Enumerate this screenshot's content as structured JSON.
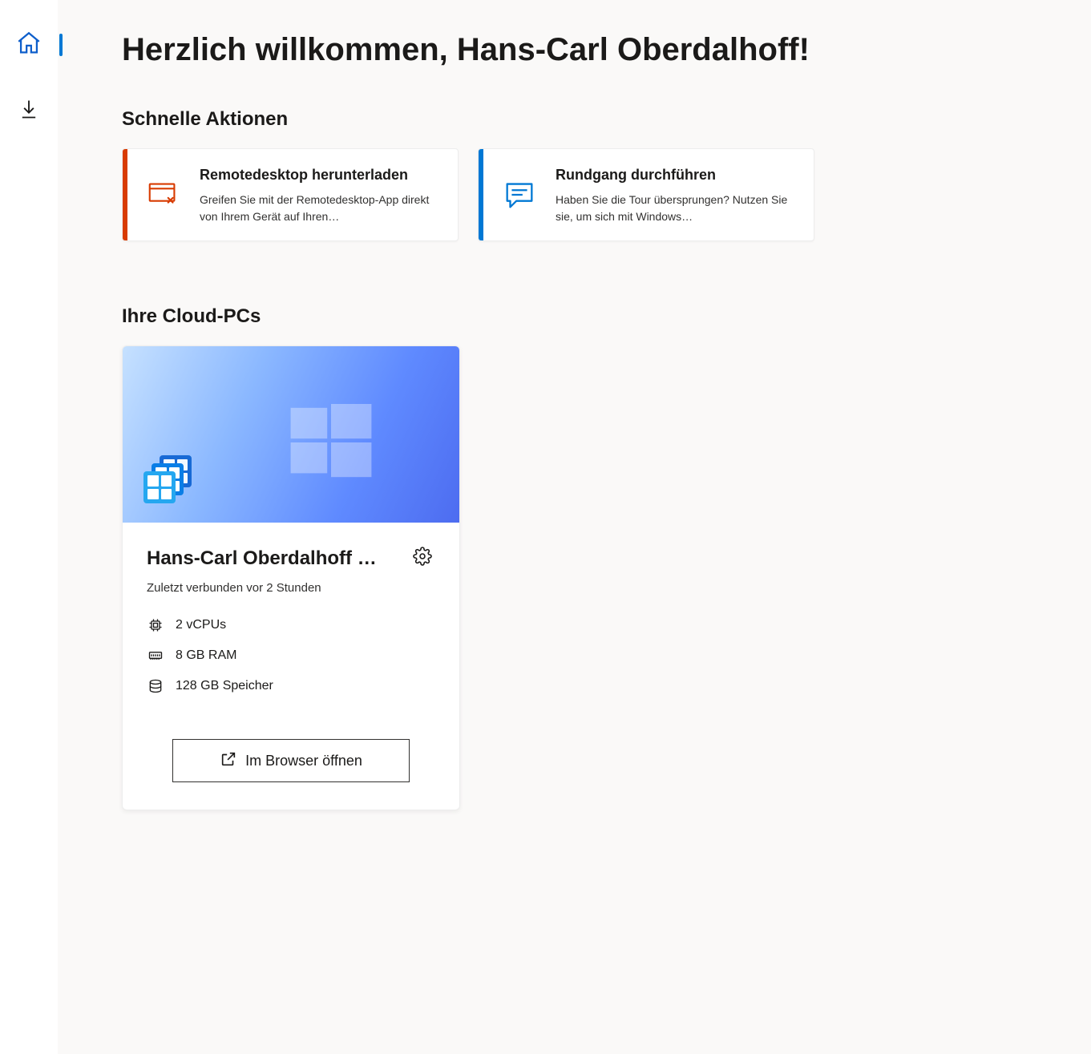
{
  "sidebar": {
    "home_aria": "Start",
    "download_aria": "Download"
  },
  "page": {
    "welcome": "Herzlich willkommen, Hans-Carl Oberdalhoff!"
  },
  "quick": {
    "heading": "Schnelle Aktionen",
    "cards": [
      {
        "title": "Remotedesktop herunterladen",
        "desc": "Greifen Sie mit der Remotedesktop-App direkt von Ihrem Gerät auf Ihren…"
      },
      {
        "title": "Rundgang durchführen",
        "desc": "Haben Sie die Tour übersprungen? Nutzen Sie sie, um sich mit Windows…"
      }
    ]
  },
  "cloud": {
    "heading": "Ihre Cloud-PCs",
    "pc": {
      "title": "Hans-Carl Oberdalhoff …",
      "subtitle": "Zuletzt verbunden vor 2 Stunden",
      "specs": {
        "cpu": "2 vCPUs",
        "ram": "8 GB RAM",
        "storage": "128 GB Speicher"
      },
      "open_label": "Im Browser öffnen"
    }
  }
}
